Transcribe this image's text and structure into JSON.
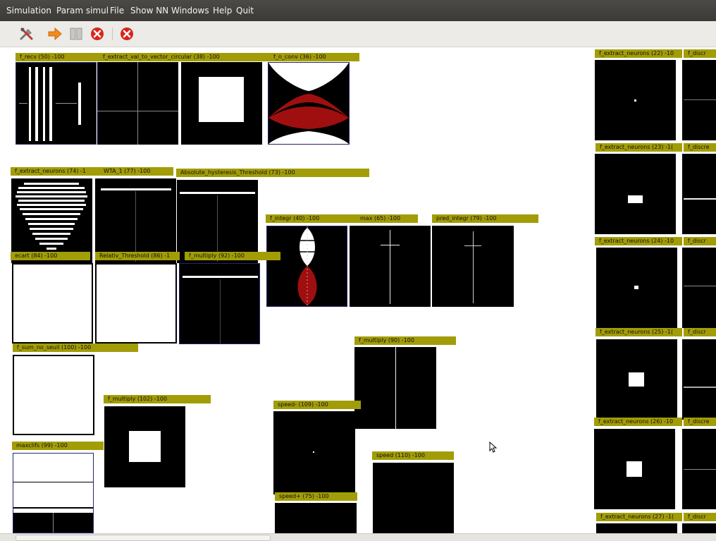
{
  "menu": {
    "items": [
      {
        "label": "Simulation"
      },
      {
        "label": "Param simul"
      },
      {
        "label": "File"
      },
      {
        "label": "Show NN"
      },
      {
        "label": "Windows"
      },
      {
        "label": "Help"
      },
      {
        "label": "Quit"
      }
    ]
  },
  "toolbar": {
    "buttons": [
      "settings-icon",
      "play-arrow-icon",
      "pause-icon",
      "stop-icon",
      "quit-icon"
    ],
    "colors": {
      "arrow": "#f28a1c",
      "stop": "#d9241e"
    }
  },
  "groups": {
    "header_color": "#a29d07",
    "labels": {
      "f_recv": "f_recv (50) -100",
      "f_extract_val": "f_extract_val_to_vector_circular (38) -100",
      "f_n_conv": "f_n_conv (36) -100",
      "f_extract_neurons_74": "f_extract_neurons (74) -1",
      "wta": "WTA_1 (77) -100",
      "abs_hyst": "Absolute_hysteresis_Threshold (73) -100",
      "f_integr": "f_integr (40) -100",
      "max": "max (65) -100",
      "pred_integr": "pred_integr (79) -100",
      "ecart": "ecart (84) -100",
      "relativ": "Relativ_Threshold (86) -1",
      "f_multiply_92": "f_multiply (92) -100",
      "f_sum": "f_sum_no_seuil (100) -100",
      "f_multiply_90": "f_multiply (90) -100",
      "f_multiply_102": "f_multiply (102) -100",
      "speed_minus": "speed- (109) -100",
      "maxcliffs": "maxclifs (99) -100",
      "speed": "speed (110) -100",
      "speed_plus": "speed+ (75) -100",
      "fx22": "f_extract_neurons (22) -10",
      "fx23": "f_extract_neurons (23) -1(",
      "fx24": "f_extract_neurons (24) -10",
      "fx25": "f_extract_neurons (25) -1(",
      "fx26": "f_extract_neurons (26) -10",
      "fx27": "f_extract_neurons (27) -1(",
      "fdisc_a": "f_discr",
      "fdisc_b": "f_discre",
      "fdisc_c": "f_discr"
    }
  },
  "scrollbar": {
    "orientation": "horizontal"
  }
}
